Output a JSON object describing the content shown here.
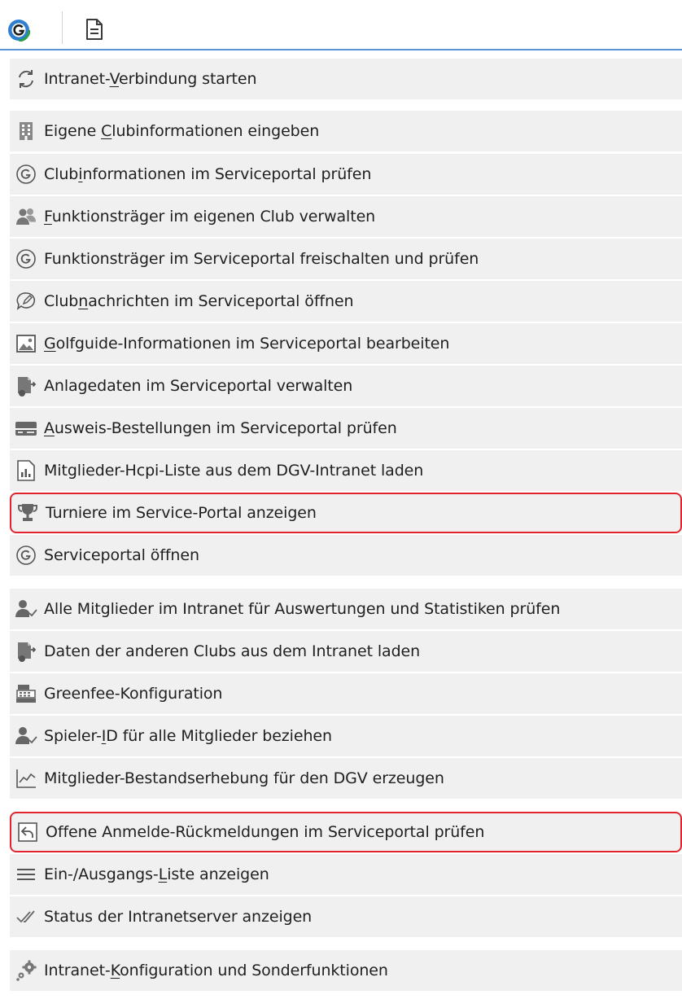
{
  "toolbar": {
    "logo_icon": "dgv-golf-logo-icon",
    "document_icon": "document-icon",
    "accent_color": "#5b95d6"
  },
  "highlight_color": "#e0232e",
  "menu": {
    "items": [
      {
        "pre": "Intranet-",
        "key": "V",
        "post": "erbindung starten",
        "icon": "sync-icon"
      },
      {
        "pre": "Eigene ",
        "key": "C",
        "post": "lubinformationen eingeben",
        "icon": "building-icon"
      },
      {
        "pre": "Club",
        "key": "i",
        "post": "nformationen im Serviceportal prüfen",
        "icon": "g-circle-icon"
      },
      {
        "pre": "",
        "key": "F",
        "post": "unktionsträger im eigenen Club verwalten",
        "icon": "people-icon"
      },
      {
        "pre": "",
        "key": "",
        "post": "Funktionsträger im Serviceportal freischalten und prüfen",
        "icon": "g-circle-icon"
      },
      {
        "pre": "Club",
        "key": "n",
        "post": "achrichten im Serviceportal öffnen",
        "icon": "message-icon"
      },
      {
        "pre": "",
        "key": "G",
        "post": "olfguide-Informationen im Serviceportal bearbeiten",
        "icon": "image-icon"
      },
      {
        "pre": "",
        "key": "",
        "post": "Anlagedaten im Serviceportal verwalten",
        "icon": "course-data-icon"
      },
      {
        "pre": "",
        "key": "A",
        "post": "usweis-Bestellungen im Serviceportal prüfen",
        "icon": "card-icon"
      },
      {
        "pre": "",
        "key": "",
        "post": "Mitglieder-Hcpi-Liste aus dem DGV-Intranet laden",
        "icon": "chart-file-icon"
      },
      {
        "pre": "",
        "key": "",
        "post": "Turniere im Service-Portal anzeigen",
        "icon": "trophy-icon"
      },
      {
        "pre": "",
        "key": "",
        "post": "Serviceportal öffnen",
        "icon": "g-circle-icon"
      },
      {
        "pre": "",
        "key": "",
        "post": "Alle Mitglieder im Intranet für Auswertungen und Statistiken prüfen",
        "icon": "user-check-icon"
      },
      {
        "pre": "",
        "key": "",
        "post": "Daten der anderen Clubs aus dem Intranet laden",
        "icon": "course-data-icon"
      },
      {
        "pre": "",
        "key": "",
        "post": "Greenfee-Konfiguration",
        "icon": "cash-register-icon"
      },
      {
        "pre": "Spieler-",
        "key": "I",
        "post": "D für alle Mitglieder beziehen",
        "icon": "user-check-icon"
      },
      {
        "pre": "",
        "key": "",
        "post": "Mitglieder-Bestandserhebung für den DGV erzeugen",
        "icon": "line-chart-icon"
      },
      {
        "pre": "",
        "key": "",
        "post": "Offene Anmelde-Rückmeldungen im Serviceportal prüfen",
        "icon": "reply-icon"
      },
      {
        "pre": "Ein-/Ausgangs-",
        "key": "L",
        "post": "iste anzeigen",
        "icon": "list-icon"
      },
      {
        "pre": "",
        "key": "",
        "post": "Status der Intranetserver anzeigen",
        "icon": "double-check-icon"
      },
      {
        "pre": "Intranet-",
        "key": "K",
        "post": "onfiguration und Sonderfunktionen",
        "icon": "gears-icon"
      }
    ]
  }
}
